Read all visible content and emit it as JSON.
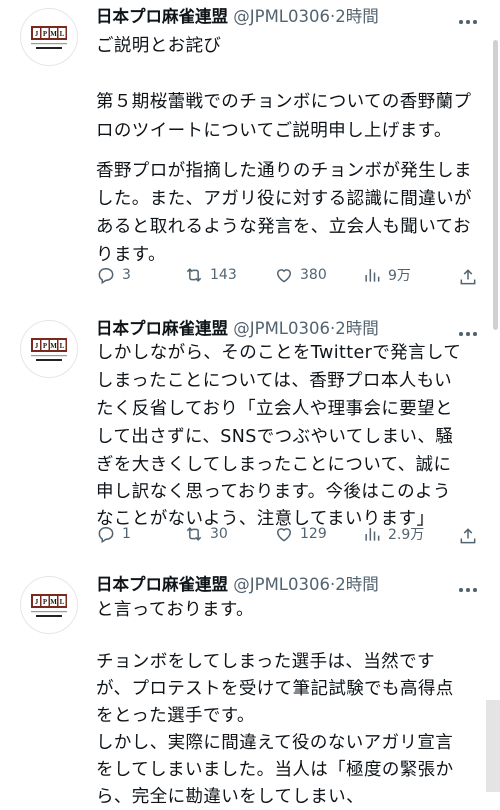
{
  "account": {
    "name": "日本プロ麻雀連盟",
    "handle": "@JPML0306",
    "separator": "·",
    "time": "2時間",
    "logo_text": "JPML",
    "logo_sub": "Japan Professional Mahjong League",
    "logo_jp": "日本プロ麻雀連盟"
  },
  "tweets": [
    {
      "lines": [
        "ご説明とお詫び",
        "",
        "第５期桜蕾戦でのチョンボについての香野蘭プ",
        "ロのツイートについてご説明申し上げます。",
        "",
        "香野プロが指摘した通りのチョンボが発生しま",
        "した。また、アガリ役に対する認識に間違いが",
        "あると取れるような発言を、立会人も聞いてお",
        "ります。"
      ],
      "replies": "3",
      "retweets": "143",
      "likes": "380",
      "views": "9万"
    },
    {
      "lines": [
        "しかしながら、そのことをTwitterで発言して",
        "しまったことについては、香野プロ本人もい",
        "たく反省しており「立会人や理事会に要望と",
        "して出さずに、SNSでつぶやいてしまい、騒",
        "ぎを大きくしてしまったことについて、誠に",
        "申し訳なく思っております。今後はこのよう",
        "なことがないよう、注意してまいります」"
      ],
      "replies": "1",
      "retweets": "30",
      "likes": "129",
      "views": "2.9万"
    },
    {
      "lines": [
        "と言っております。",
        "",
        "チョンボをしてしまった選手は、当然です",
        "が、プロテストを受けて筆記試験でも高得点",
        "をとった選手です。",
        "しかし、実際に間違えて役のないアガリ宣言",
        "をしてしまいました。当人は「極度の緊張か",
        "ら、完全に勘違いをしてしまい、"
      ]
    }
  ]
}
